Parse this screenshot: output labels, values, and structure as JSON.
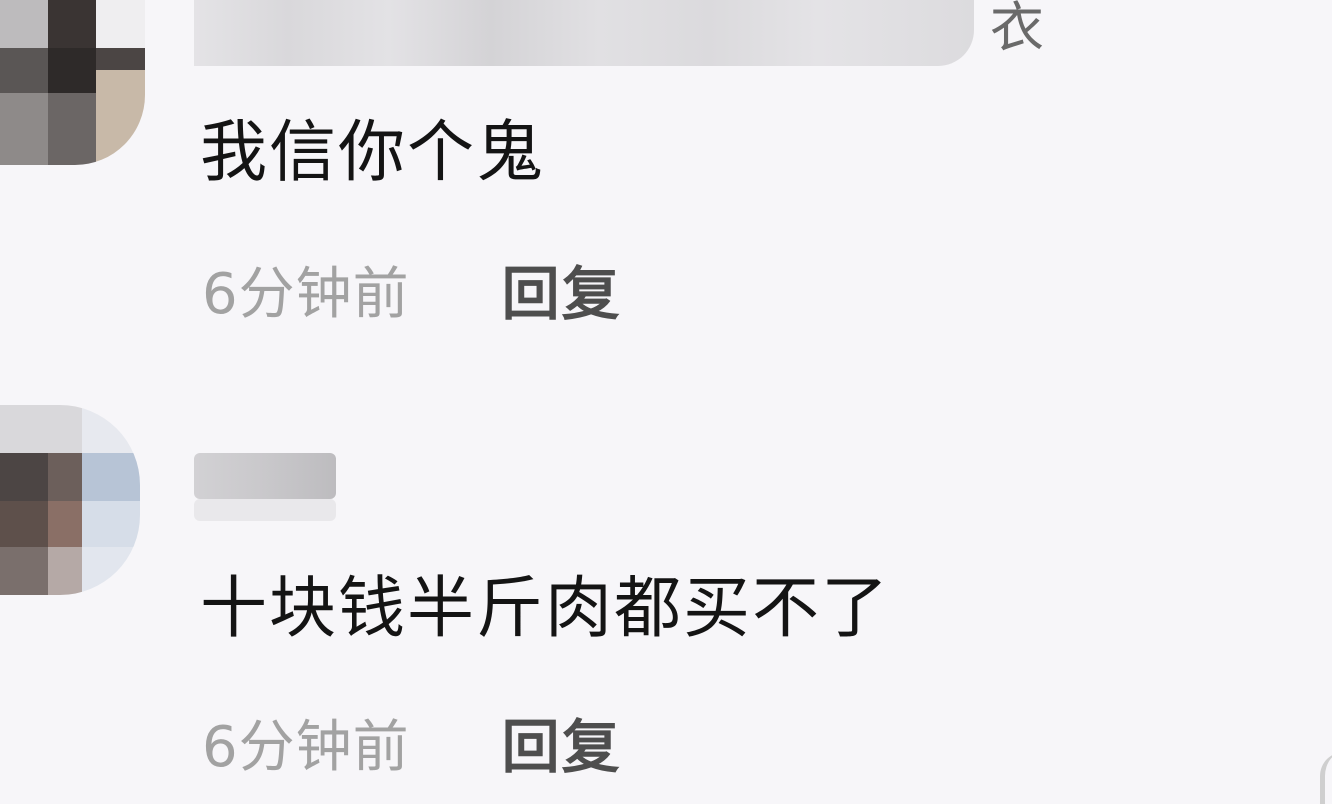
{
  "comments": [
    {
      "username_fragment": "",
      "text": "我信你个鬼",
      "time": "6分钟前",
      "reply_label": "回复"
    },
    {
      "username_fragment": "",
      "text": "十块钱半斤肉都买不了",
      "time": "6分钟前",
      "reply_label": "回复"
    }
  ],
  "colors": {
    "background": "#f7f6f9",
    "comment_text": "#141414",
    "timestamp": "#a2a2a2",
    "reply": "#4e4e4e"
  },
  "icons": [
    "avatar-pixelated",
    "avatar-pixelated"
  ]
}
